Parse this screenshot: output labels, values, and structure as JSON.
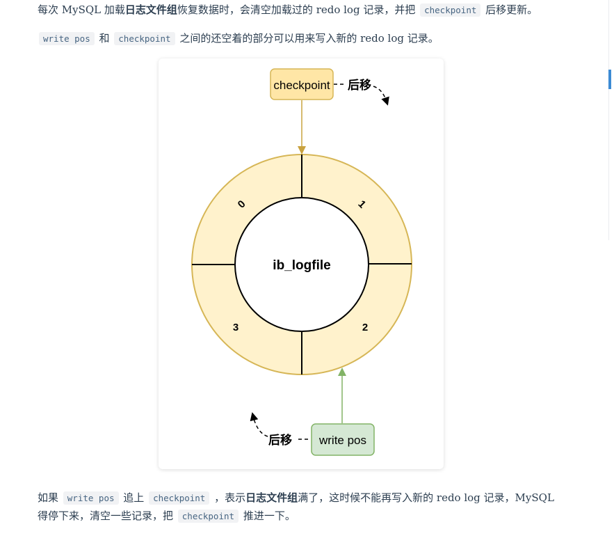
{
  "paragraph1": {
    "t1": "每次 MySQL 加载",
    "bold": "日志文件组",
    "t2": "恢复数据时，会清空加载过的 redo log 记录，并把 ",
    "code": "checkpoint",
    "t3": " 后移更新。"
  },
  "paragraph2": {
    "code1": "write pos",
    "t1": " 和 ",
    "code2": "checkpoint",
    "t2": " 之间的还空着的部分可以用来写入新的 redo log 记录。"
  },
  "diagram": {
    "center_label": "ib_logfile",
    "segments": [
      "0",
      "1",
      "2",
      "3"
    ],
    "checkpoint_label": "checkpoint",
    "write_pos_label": "write pos",
    "move_label_top": "后移",
    "move_label_bottom": "后移",
    "colors": {
      "ring_fill": "#fff2cc",
      "ring_stroke": "#d6b656",
      "checkpoint_fill": "#ffe6a6",
      "checkpoint_stroke": "#d6b656",
      "write_pos_fill": "#d5e8d4",
      "write_pos_stroke": "#82b366"
    }
  },
  "paragraph3": {
    "t1": "如果 ",
    "code1": "write pos",
    "t2": " 追上 ",
    "code2": "checkpoint",
    "t3": " ，表示",
    "bold": "日志文件组",
    "t4": "满了，这时候不能再写入新的 redo log 记录，MySQL"
  },
  "paragraph4": {
    "t1": "得停下来，清空一些记录，把 ",
    "code": "checkpoint",
    "t2": " 推进一下。"
  }
}
